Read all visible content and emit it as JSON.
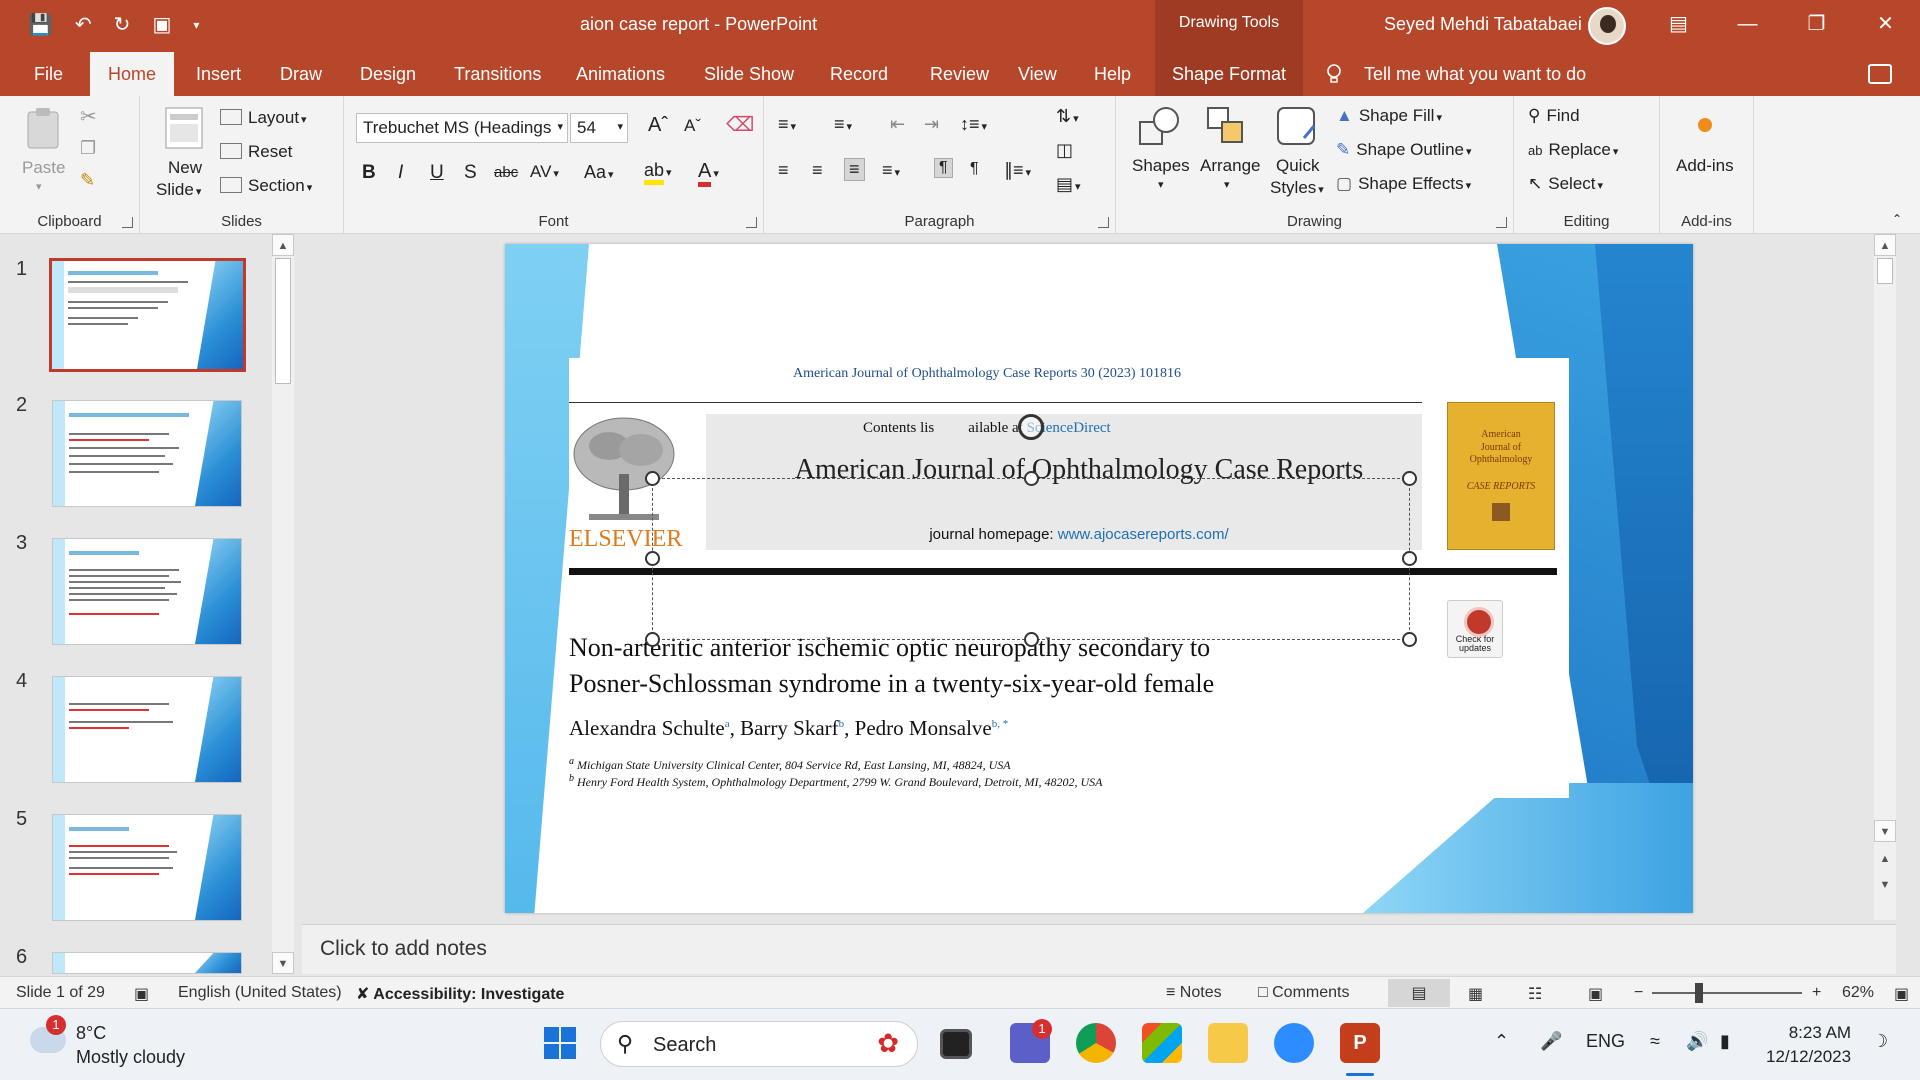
{
  "window": {
    "title": "aion case report  -  PowerPoint",
    "context_tab_title": "Drawing Tools",
    "user": "Seyed Mehdi Tabatabaei",
    "accent": "#b7472a"
  },
  "tabs": {
    "file": "File",
    "home": "Home",
    "insert": "Insert",
    "draw": "Draw",
    "design": "Design",
    "transitions": "Transitions",
    "animations": "Animations",
    "slideshow": "Slide Show",
    "record": "Record",
    "review": "Review",
    "view": "View",
    "help": "Help",
    "shape_format": "Shape Format",
    "tell_me": "Tell me what you want to do"
  },
  "ribbon": {
    "clipboard": {
      "label": "Clipboard",
      "paste": "Paste"
    },
    "slides": {
      "label": "Slides",
      "new": "New",
      "slide": "Slide",
      "layout": "Layout",
      "reset": "Reset",
      "section": "Section"
    },
    "font": {
      "label": "Font",
      "family": "Trebuchet MS (Headings",
      "size": "54"
    },
    "paragraph": {
      "label": "Paragraph"
    },
    "drawing": {
      "label": "Drawing",
      "shapes": "Shapes",
      "arrange": "Arrange",
      "quick": "Quick",
      "styles": "Styles",
      "fill": "Shape Fill",
      "outline": "Shape Outline",
      "effects": "Shape Effects"
    },
    "editing": {
      "label": "Editing",
      "find": "Find",
      "replace": "Replace",
      "select": "Select"
    },
    "addins": {
      "label": "Add-ins",
      "button": "Add-ins"
    }
  },
  "thumbnails": [
    {
      "num": "1",
      "selected": true
    },
    {
      "num": "2",
      "selected": false
    },
    {
      "num": "3",
      "selected": false
    },
    {
      "num": "4",
      "selected": false
    },
    {
      "num": "5",
      "selected": false
    },
    {
      "num": "6",
      "selected": false
    }
  ],
  "slide": {
    "citation": "American Journal of Ophthalmology Case Reports 30 (2023) 101816",
    "contents_prefix": "Contents lis",
    "contents_suffix": "ailable at",
    "sciencedirect": "ScienceDirect",
    "journal": "American Journal of Ophthalmology Case Reports",
    "homepage_label": "journal homepage:",
    "homepage_url": "www.ajocasereports.com/",
    "publisher": "ELSEVIER",
    "cover_line1": "American",
    "cover_line2": "Journal of",
    "cover_line3": "Ophthalmology",
    "cover_sub": "CASE REPORTS",
    "check_updates": "Check for updates",
    "article_line1": "Non-arteritic anterior ischemic optic neuropathy secondary to",
    "article_line2": "Posner-Schlossman syndrome in a twenty-six-year-old female",
    "author1": "Alexandra Schulte",
    "author1_sup": "a",
    "author2": "Barry Skarf",
    "author2_sup": "b",
    "author3": "Pedro Monsalve",
    "author3_sup": "b, *",
    "aff_a": "Michigan State University Clinical Center, 804 Service Rd, East Lansing, MI, 48824, USA",
    "aff_b": "Henry Ford Health System, Ophthalmology Department, 2799 W. Grand Boulevard, Detroit, MI, 48202, USA",
    "aff_a_mark": "a",
    "aff_b_mark": "b"
  },
  "notes": {
    "placeholder": "Click to add notes"
  },
  "status": {
    "slide": "Slide 1 of 29",
    "language": "English (United States)",
    "accessibility": "Accessibility: Investigate",
    "notes": "Notes",
    "comments": "Comments",
    "zoom": "62%"
  },
  "taskbar": {
    "temperature": "8°C",
    "condition": "Mostly cloudy",
    "weather_badge": "1",
    "search": "Search",
    "teams_badge": "1",
    "lang": "ENG",
    "time": "8:23 AM",
    "date": "12/12/2023"
  }
}
